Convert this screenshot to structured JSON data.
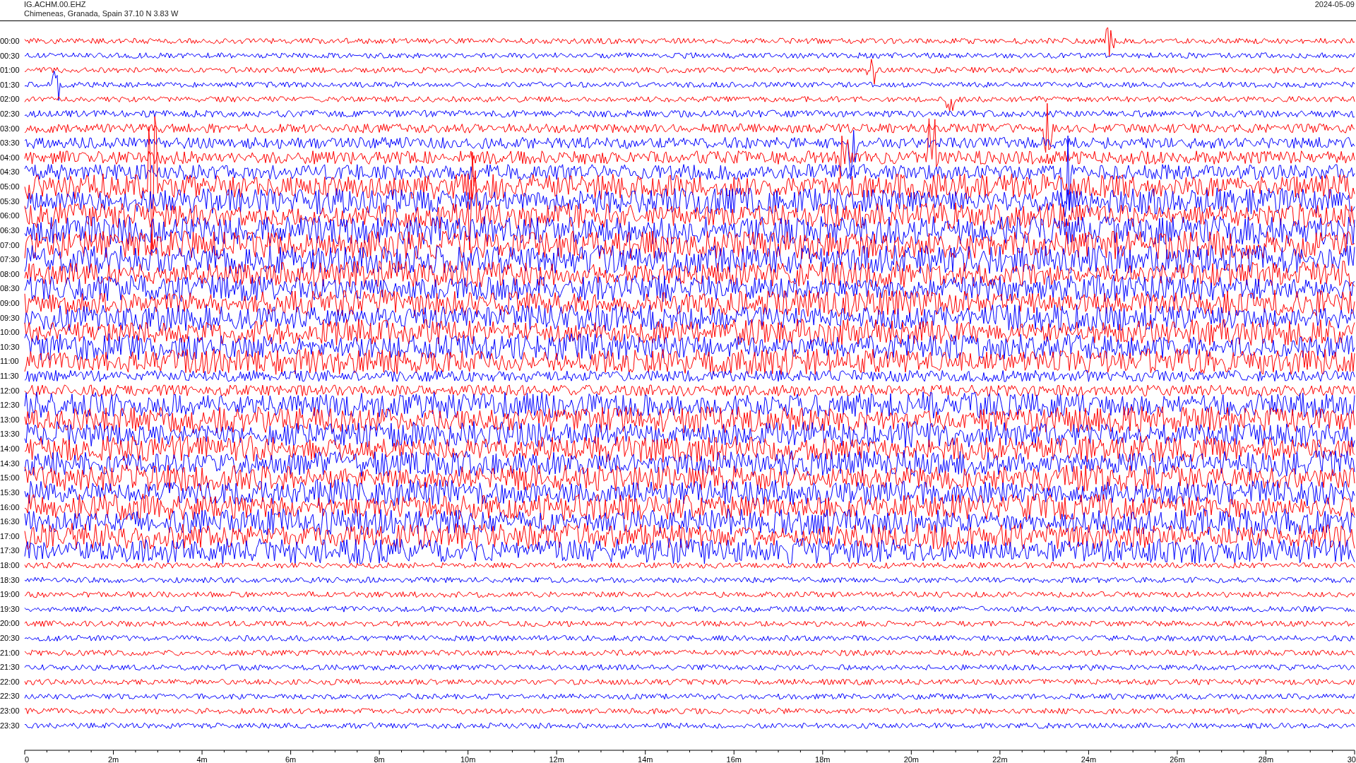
{
  "header": {
    "station": "IG.ACHM.00.EHZ",
    "location": "Chimeneas, Granada, Spain  37.10 N 3.83 W",
    "date": "2024-05-09"
  },
  "rows": [
    {
      "time": "00:00",
      "color": "#ff0000"
    },
    {
      "time": "00:30",
      "color": "#0000ff"
    },
    {
      "time": "01:00",
      "color": "#ff0000"
    },
    {
      "time": "01:30",
      "color": "#0000ff"
    },
    {
      "time": "02:00",
      "color": "#ff0000"
    },
    {
      "time": "02:30",
      "color": "#0000ff"
    },
    {
      "time": "03:00",
      "color": "#ff0000"
    },
    {
      "time": "03:30",
      "color": "#0000ff"
    },
    {
      "time": "04:00",
      "color": "#ff0000"
    },
    {
      "time": "04:30",
      "color": "#0000ff"
    },
    {
      "time": "05:00",
      "color": "#ff0000"
    },
    {
      "time": "05:30",
      "color": "#0000ff"
    },
    {
      "time": "06:00",
      "color": "#ff0000"
    },
    {
      "time": "06:30",
      "color": "#0000ff"
    },
    {
      "time": "07:00",
      "color": "#ff0000"
    },
    {
      "time": "07:30",
      "color": "#0000ff"
    },
    {
      "time": "08:00",
      "color": "#ff0000"
    },
    {
      "time": "08:30",
      "color": "#0000ff"
    },
    {
      "time": "09:00",
      "color": "#ff0000"
    },
    {
      "time": "09:30",
      "color": "#0000ff"
    },
    {
      "time": "10:00",
      "color": "#ff0000"
    },
    {
      "time": "10:30",
      "color": "#0000ff"
    },
    {
      "time": "11:00",
      "color": "#ff0000"
    },
    {
      "time": "11:30",
      "color": "#0000ff"
    },
    {
      "time": "12:00",
      "color": "#ff0000"
    },
    {
      "time": "12:30",
      "color": "#0000ff"
    },
    {
      "time": "13:00",
      "color": "#ff0000"
    },
    {
      "time": "13:30",
      "color": "#0000ff"
    },
    {
      "time": "14:00",
      "color": "#ff0000"
    },
    {
      "time": "14:30",
      "color": "#0000ff"
    },
    {
      "time": "15:00",
      "color": "#ff0000"
    },
    {
      "time": "15:30",
      "color": "#0000ff"
    },
    {
      "time": "16:00",
      "color": "#ff0000"
    },
    {
      "time": "16:30",
      "color": "#0000ff"
    },
    {
      "time": "17:00",
      "color": "#ff0000"
    },
    {
      "time": "17:30",
      "color": "#0000ff"
    },
    {
      "time": "18:00",
      "color": "#ff0000"
    },
    {
      "time": "18:30",
      "color": "#0000ff"
    },
    {
      "time": "19:00",
      "color": "#ff0000"
    },
    {
      "time": "19:30",
      "color": "#0000ff"
    },
    {
      "time": "20:00",
      "color": "#ff0000"
    },
    {
      "time": "20:30",
      "color": "#0000ff"
    },
    {
      "time": "21:00",
      "color": "#ff0000"
    },
    {
      "time": "21:30",
      "color": "#0000ff"
    },
    {
      "time": "22:00",
      "color": "#ff0000"
    },
    {
      "time": "22:30",
      "color": "#0000ff"
    },
    {
      "time": "23:00",
      "color": "#ff0000"
    },
    {
      "time": "23:30",
      "color": "#0000ff"
    }
  ],
  "x_axis": {
    "ticks": [
      "0",
      "2m",
      "4m",
      "6m",
      "8m",
      "10m",
      "12m",
      "14m",
      "16m",
      "18m",
      "20m",
      "22m",
      "24m",
      "26m",
      "28m",
      "30"
    ]
  }
}
